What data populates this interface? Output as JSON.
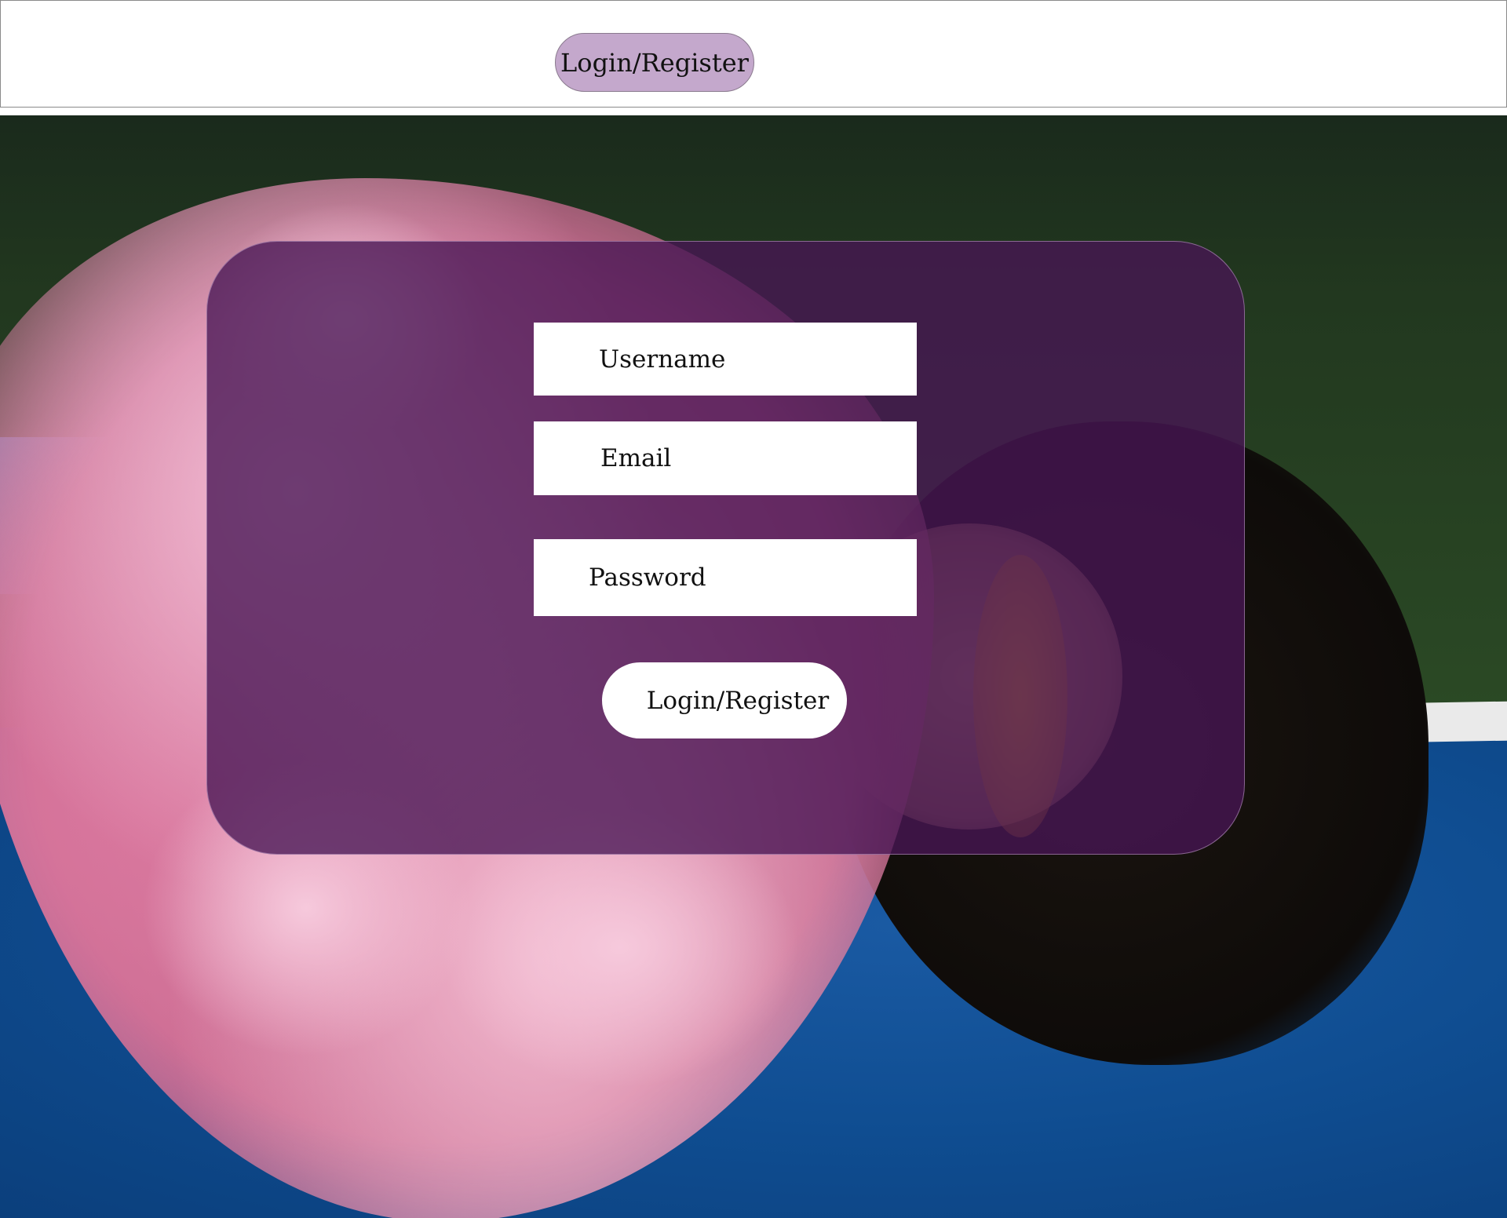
{
  "header": {
    "nav_button_label": "Login/Register"
  },
  "form": {
    "username_label": "Username",
    "email_label": "Email",
    "password_label": "Password",
    "submit_label": "Login/Register"
  },
  "colors": {
    "nav_button_bg": "#c4a8cc",
    "card_overlay": "#481654",
    "field_bg": "#ffffff"
  }
}
